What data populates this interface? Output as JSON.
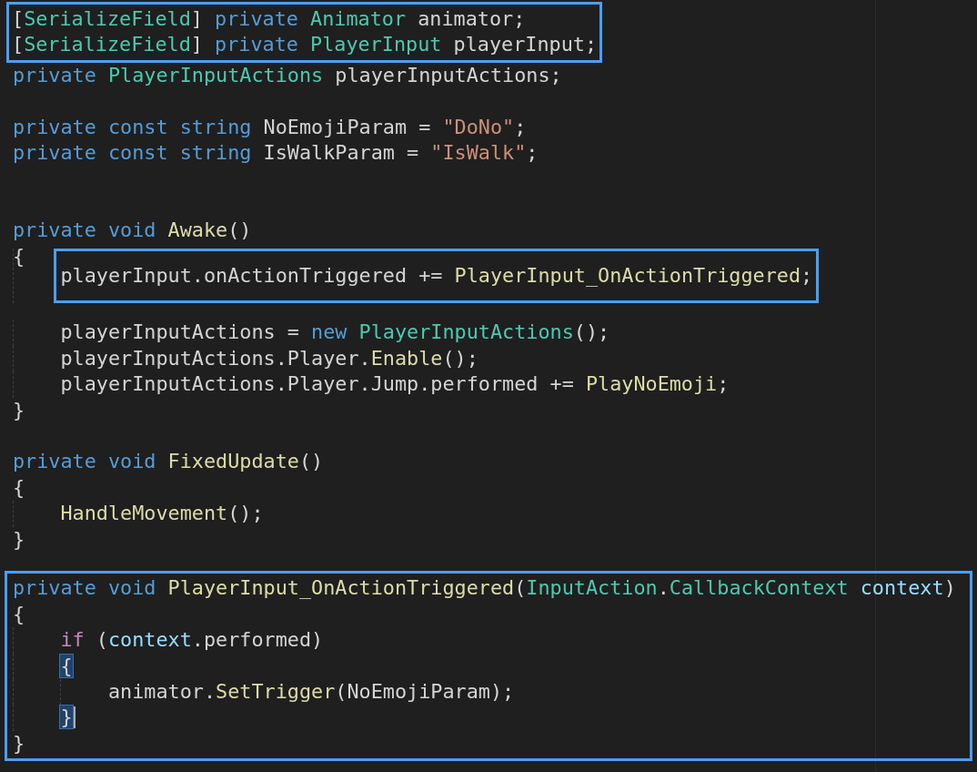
{
  "editor": {
    "lines": [
      {
        "kind": "frame",
        "children": [
          {
            "kind": "code",
            "tokens": [
              {
                "text": "[",
                "kind": "plain"
              },
              {
                "text": "SerializeField",
                "kind": "type"
              },
              {
                "text": "] ",
                "kind": "plain"
              },
              {
                "text": "private ",
                "kind": "keyword"
              },
              {
                "text": "Animator ",
                "kind": "type"
              },
              {
                "text": "animator;",
                "kind": "plain"
              }
            ]
          },
          {
            "kind": "code",
            "tokens": [
              {
                "text": "[",
                "kind": "plain"
              },
              {
                "text": "SerializeField",
                "kind": "type"
              },
              {
                "text": "] ",
                "kind": "plain"
              },
              {
                "text": "private ",
                "kind": "keyword"
              },
              {
                "text": "PlayerInput ",
                "kind": "type"
              },
              {
                "text": "playerInput;",
                "kind": "plain"
              }
            ]
          }
        ]
      },
      {
        "kind": "code",
        "tokens": [
          {
            "text": "private ",
            "kind": "keyword"
          },
          {
            "text": "PlayerInputActions ",
            "kind": "type"
          },
          {
            "text": "playerInputActions;",
            "kind": "plain"
          }
        ]
      },
      {
        "kind": "blank"
      },
      {
        "kind": "code",
        "tokens": [
          {
            "text": "private const string ",
            "kind": "keyword"
          },
          {
            "text": "NoEmojiParam = ",
            "kind": "plain"
          },
          {
            "text": "\"DoNo\"",
            "kind": "string"
          },
          {
            "text": ";",
            "kind": "plain"
          }
        ]
      },
      {
        "kind": "code",
        "tokens": [
          {
            "text": "private const string ",
            "kind": "keyword"
          },
          {
            "text": "IsWalkParam = ",
            "kind": "plain"
          },
          {
            "text": "\"IsWalk\"",
            "kind": "string"
          },
          {
            "text": ";",
            "kind": "plain"
          }
        ]
      },
      {
        "kind": "blank"
      },
      {
        "kind": "blank"
      },
      {
        "kind": "code",
        "tokens": [
          {
            "text": "private void ",
            "kind": "keyword"
          },
          {
            "text": "Awake",
            "kind": "function"
          },
          {
            "text": "()",
            "kind": "plain"
          }
        ]
      },
      {
        "kind": "code",
        "tokens": [
          {
            "text": "{",
            "kind": "plain"
          }
        ],
        "children": [
          {
            "kind": "frame",
            "children": [
              {
                "kind": "code",
                "tokens": [
                  {
                    "text": "playerInput.onActionTriggered += ",
                    "kind": "plain"
                  },
                  {
                    "text": "PlayerInput_OnActionTriggered",
                    "kind": "function"
                  },
                  {
                    "text": ";",
                    "kind": "plain"
                  }
                ]
              }
            ]
          },
          {
            "kind": "code",
            "tokens": [
              {
                "text": "playerInputActions = ",
                "kind": "plain"
              },
              {
                "text": "new ",
                "kind": "keyword"
              },
              {
                "text": "PlayerInputActions",
                "kind": "type"
              },
              {
                "text": "();",
                "kind": "plain"
              }
            ]
          },
          {
            "kind": "code",
            "tokens": [
              {
                "text": "playerInputActions.Player.",
                "kind": "plain"
              },
              {
                "text": "Enable",
                "kind": "function"
              },
              {
                "text": "();",
                "kind": "plain"
              }
            ]
          },
          {
            "kind": "code",
            "tokens": [
              {
                "text": "playerInputActions.Player.Jump.performed += ",
                "kind": "plain"
              },
              {
                "text": "PlayNoEmoji",
                "kind": "function"
              },
              {
                "text": ";",
                "kind": "plain"
              }
            ]
          }
        ]
      },
      {
        "kind": "code",
        "tokens": [
          {
            "text": "}",
            "kind": "plain"
          }
        ]
      },
      {
        "kind": "blank"
      },
      {
        "kind": "code",
        "tokens": [
          {
            "text": "private void ",
            "kind": "keyword"
          },
          {
            "text": "FixedUpdate",
            "kind": "function"
          },
          {
            "text": "()",
            "kind": "plain"
          }
        ]
      },
      {
        "kind": "code",
        "tokens": [
          {
            "text": "{",
            "kind": "plain"
          }
        ],
        "children": [
          {
            "kind": "code",
            "tokens": [
              {
                "text": "HandleMovement",
                "kind": "function"
              },
              {
                "text": "();",
                "kind": "plain"
              }
            ]
          }
        ]
      },
      {
        "kind": "code",
        "tokens": [
          {
            "text": "}",
            "kind": "plain"
          }
        ]
      },
      {
        "kind": "blank"
      },
      {
        "kind": "frame",
        "children": [
          {
            "kind": "code",
            "tokens": [
              {
                "text": "private void ",
                "kind": "keyword"
              },
              {
                "text": "PlayerInput_OnActionTriggered",
                "kind": "function"
              },
              {
                "text": "(",
                "kind": "plain"
              },
              {
                "text": "InputAction",
                "kind": "type"
              },
              {
                "text": ".",
                "kind": "plain"
              },
              {
                "text": "CallbackContext ",
                "kind": "type"
              },
              {
                "text": "context",
                "kind": "parameter"
              },
              {
                "text": ")",
                "kind": "plain"
              }
            ]
          },
          {
            "kind": "code",
            "tokens": [
              {
                "text": "{",
                "kind": "plain"
              }
            ],
            "children": [
              {
                "kind": "code",
                "tokens": [
                  {
                    "text": "if ",
                    "kind": "control"
                  },
                  {
                    "text": "(",
                    "kind": "plain"
                  },
                  {
                    "text": "context",
                    "kind": "parameter"
                  },
                  {
                    "text": ".performed)",
                    "kind": "plain"
                  }
                ]
              },
              {
                "kind": "code",
                "tokens": [
                  {
                    "text": "{",
                    "kind": "bracket-match"
                  }
                ],
                "children": [
                  {
                    "kind": "code",
                    "tokens": [
                      {
                        "text": "animator.",
                        "kind": "plain"
                      },
                      {
                        "text": "SetTrigger",
                        "kind": "function"
                      },
                      {
                        "text": "(NoEmojiParam);",
                        "kind": "plain"
                      }
                    ]
                  }
                ]
              },
              {
                "kind": "code",
                "cursor": true,
                "tokens": [
                  {
                    "text": "}",
                    "kind": "bracket-match"
                  }
                ]
              }
            ]
          },
          {
            "kind": "code",
            "tokens": [
              {
                "text": "}",
                "kind": "plain"
              }
            ]
          }
        ]
      }
    ]
  }
}
